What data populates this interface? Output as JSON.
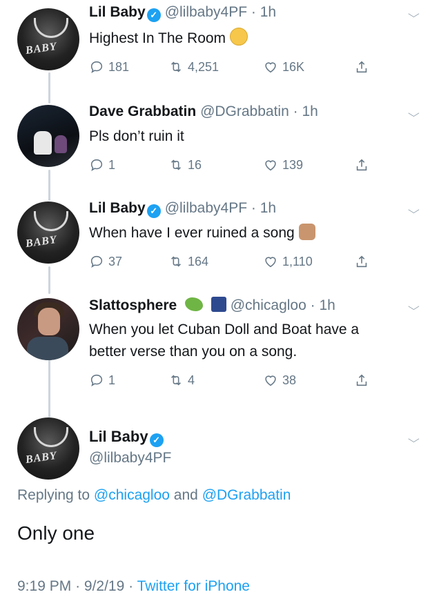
{
  "tweets": [
    {
      "name": "Lil Baby",
      "handle": "@lilbaby4PF",
      "time": "1h",
      "text": "Highest In The Room",
      "emoji": "angry-face-emoji",
      "replies": "181",
      "retweets": "4,251",
      "likes": "16K"
    },
    {
      "name": "Dave Grabbatin",
      "handle": "@DGrabbatin",
      "time": "1h",
      "text": "Pls don’t ruin it",
      "replies": "1",
      "retweets": "16",
      "likes": "139"
    },
    {
      "name": "Lil Baby",
      "handle": "@lilbaby4PF",
      "time": "1h",
      "text": "When have I ever ruined a song",
      "emoji": "shrug-emoji",
      "replies": "37",
      "retweets": "164",
      "likes": "1,110"
    },
    {
      "name": "Slattosphere",
      "handle": "@chicagloo",
      "time": "1h",
      "text_line1": "When you let Cuban Doll and Boat have a",
      "text_line2": "better verse than you on a song.",
      "replies": "1",
      "retweets": "4",
      "likes": "38"
    }
  ],
  "main_tweet": {
    "name": "Lil Baby",
    "handle": "@lilbaby4PF",
    "replying_prefix": "Replying to",
    "replying_user1": "@chicagloo",
    "replying_and": "and",
    "replying_user2": "@DGrabbatin",
    "text": "Only one",
    "time": "9:19 PM",
    "date": "9/2/19",
    "source": "Twitter for iPhone"
  },
  "avatar_label": "BABY",
  "colors": {
    "link": "#1da1f2",
    "secondary": "#657786",
    "text": "#14171a",
    "thread_line": "#ccd6dd"
  }
}
